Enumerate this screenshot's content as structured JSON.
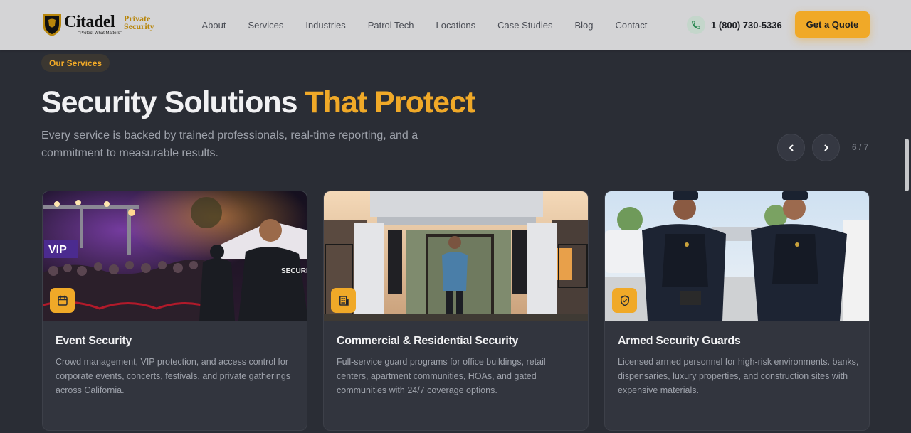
{
  "nav": {
    "logo": {
      "brand": "Citadel",
      "private_line1": "Private",
      "private_line2": "Security",
      "tagline": "\"Protect What Matters\""
    },
    "links": [
      "About",
      "Services",
      "Industries",
      "Patrol Tech",
      "Locations",
      "Case Studies",
      "Blog",
      "Contact"
    ],
    "phone": "1 (800) 730-5336",
    "cta": "Get a Quote"
  },
  "hero": {
    "badge": "Our Services",
    "title_plain": "Security Solutions ",
    "title_accent": "That Protect",
    "subtitle": "Every service is backed by trained professionals, real-time reporting, and a commitment to measurable results."
  },
  "carousel": {
    "counter": "6 / 7"
  },
  "cards": [
    {
      "title": "Event Security",
      "description": "Crowd management, VIP protection, and access control for corporate events, concerts, festivals, and private gatherings across California.",
      "icon": "calendar-icon",
      "image_sign": "VIP",
      "image_patch": "SECURITY"
    },
    {
      "title": "Commercial & Residential Security",
      "description": "Full-service guard programs for office buildings, retail centers, apartment communities, HOAs, and gated communities with 24/7 coverage options.",
      "icon": "building-icon"
    },
    {
      "title": "Armed Security Guards",
      "description": "Licensed armed personnel for high-risk environments. banks, dispensaries, luxury properties, and construction sites with expensive materials.",
      "icon": "shield-check-icon"
    }
  ],
  "colors": {
    "accent": "#f0a928",
    "background": "#2a2d35",
    "card": "#32353e",
    "nav": "#d4d4d6"
  }
}
